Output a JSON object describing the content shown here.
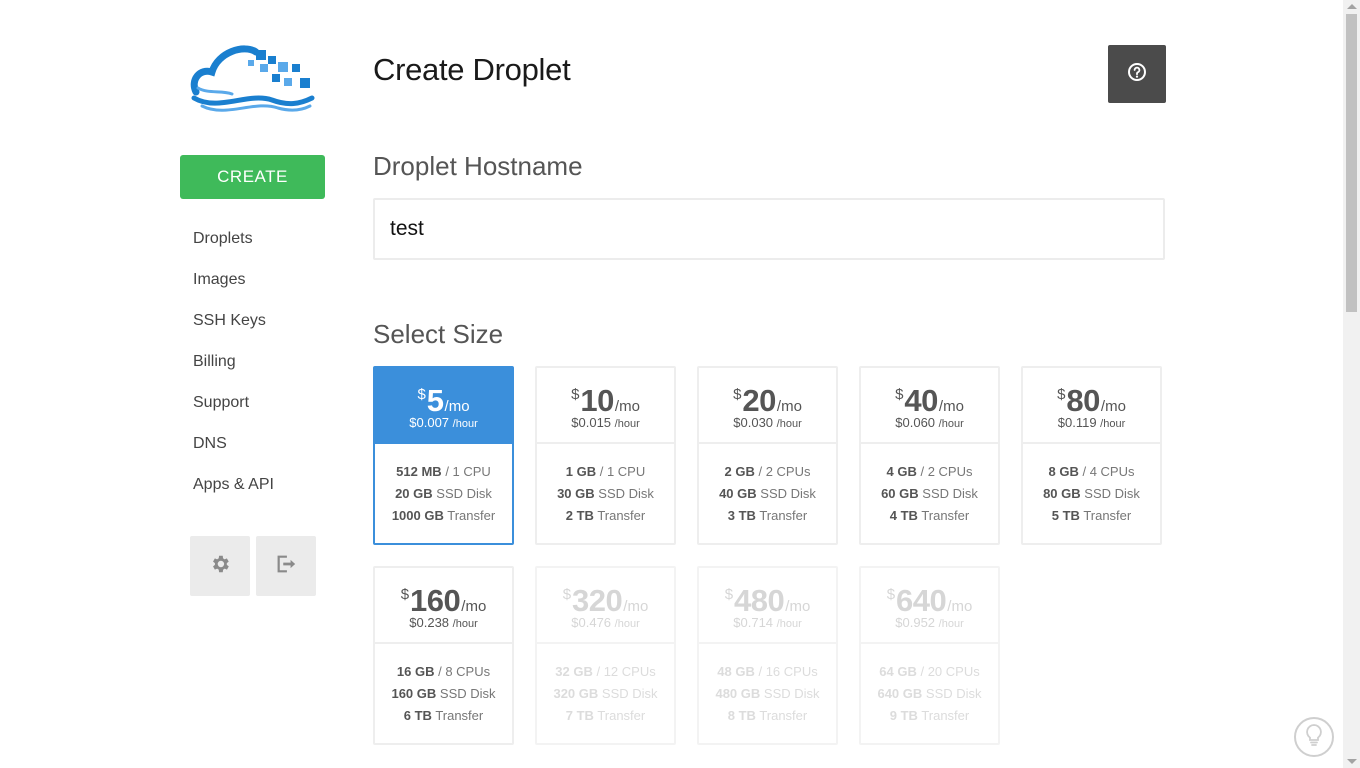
{
  "sidebar": {
    "create_label": "CREATE",
    "items": [
      {
        "label": "Droplets"
      },
      {
        "label": "Images"
      },
      {
        "label": "SSH Keys"
      },
      {
        "label": "Billing"
      },
      {
        "label": "Support"
      },
      {
        "label": "DNS"
      },
      {
        "label": "Apps & API"
      }
    ],
    "settings_icon": "gear-icon",
    "logout_icon": "sign-out-icon"
  },
  "main": {
    "title": "Create Droplet",
    "help_icon": "question-circle-icon",
    "hostname": {
      "label": "Droplet Hostname",
      "value": "test"
    },
    "size": {
      "label": "Select Size",
      "cards": [
        {
          "currency": "$",
          "price": "5",
          "per": "/mo",
          "hourly": "$0.007",
          "hour_unit": "/hour",
          "ram": "512 MB",
          "cpu": "/ 1 CPU",
          "disk": "20 GB",
          "disk_label": "SSD Disk",
          "transfer": "1000 GB",
          "transfer_label": "Transfer",
          "state": "selected"
        },
        {
          "currency": "$",
          "price": "10",
          "per": "/mo",
          "hourly": "$0.015",
          "hour_unit": "/hour",
          "ram": "1 GB",
          "cpu": "/ 1 CPU",
          "disk": "30 GB",
          "disk_label": "SSD Disk",
          "transfer": "2 TB",
          "transfer_label": "Transfer",
          "state": "available"
        },
        {
          "currency": "$",
          "price": "20",
          "per": "/mo",
          "hourly": "$0.030",
          "hour_unit": "/hour",
          "ram": "2 GB",
          "cpu": "/ 2 CPUs",
          "disk": "40 GB",
          "disk_label": "SSD Disk",
          "transfer": "3 TB",
          "transfer_label": "Transfer",
          "state": "available"
        },
        {
          "currency": "$",
          "price": "40",
          "per": "/mo",
          "hourly": "$0.060",
          "hour_unit": "/hour",
          "ram": "4 GB",
          "cpu": "/ 2 CPUs",
          "disk": "60 GB",
          "disk_label": "SSD Disk",
          "transfer": "4 TB",
          "transfer_label": "Transfer",
          "state": "available"
        },
        {
          "currency": "$",
          "price": "80",
          "per": "/mo",
          "hourly": "$0.119",
          "hour_unit": "/hour",
          "ram": "8 GB",
          "cpu": "/ 4 CPUs",
          "disk": "80 GB",
          "disk_label": "SSD Disk",
          "transfer": "5 TB",
          "transfer_label": "Transfer",
          "state": "available"
        },
        {
          "currency": "$",
          "price": "160",
          "per": "/mo",
          "hourly": "$0.238",
          "hour_unit": "/hour",
          "ram": "16 GB",
          "cpu": "/ 8 CPUs",
          "disk": "160 GB",
          "disk_label": "SSD Disk",
          "transfer": "6 TB",
          "transfer_label": "Transfer",
          "state": "available"
        },
        {
          "currency": "$",
          "price": "320",
          "per": "/mo",
          "hourly": "$0.476",
          "hour_unit": "/hour",
          "ram": "32 GB",
          "cpu": "/ 12 CPUs",
          "disk": "320 GB",
          "disk_label": "SSD Disk",
          "transfer": "7 TB",
          "transfer_label": "Transfer",
          "state": "disabled"
        },
        {
          "currency": "$",
          "price": "480",
          "per": "/mo",
          "hourly": "$0.714",
          "hour_unit": "/hour",
          "ram": "48 GB",
          "cpu": "/ 16 CPUs",
          "disk": "480 GB",
          "disk_label": "SSD Disk",
          "transfer": "8 TB",
          "transfer_label": "Transfer",
          "state": "disabled"
        },
        {
          "currency": "$",
          "price": "640",
          "per": "/mo",
          "hourly": "$0.952",
          "hour_unit": "/hour",
          "ram": "64 GB",
          "cpu": "/ 20 CPUs",
          "disk": "640 GB",
          "disk_label": "SSD Disk",
          "transfer": "9 TB",
          "transfer_label": "Transfer",
          "state": "disabled"
        }
      ]
    }
  },
  "feedback_icon": "lightbulb-icon",
  "colors": {
    "accent_green": "#3fba5a",
    "selected_blue": "#3b8fdb",
    "help_button": "#4b4b4b",
    "logo_blue": "#1a7fcf"
  }
}
